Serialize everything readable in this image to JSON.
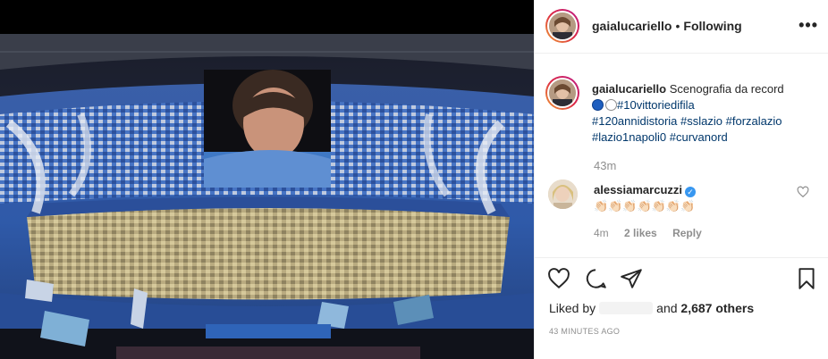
{
  "post": {
    "username": "gaialucariello",
    "separator": "•",
    "follow_status": "Following",
    "more_label": "•••"
  },
  "caption": {
    "username": "gaialucariello",
    "text": "Scenografia da record",
    "hashtags": [
      "#10vittoriedifila",
      "#120annidistoria",
      "#sslazio",
      "#forzalazio",
      "#lazio1napoli0",
      "#curvanord"
    ],
    "time": "43m"
  },
  "reply": {
    "username": "alessiamarcuzzi",
    "verified_icon": "verified-badge-icon",
    "emoji": "👏🏻👏🏻👏🏻👏🏻👏🏻👏🏻👏🏻",
    "time": "4m",
    "likes": "2 likes",
    "reply_label": "Reply"
  },
  "actions": {
    "icons": [
      "heart-icon",
      "comment-icon",
      "share-icon",
      "bookmark-icon"
    ]
  },
  "likes": {
    "prefix": "Liked by",
    "conjunction": "and",
    "count": "2,687 others"
  },
  "posted_time": "43 MINUTES AGO",
  "colors": {
    "link": "#00376b",
    "muted": "#8e8e8e",
    "verified": "#3897f0",
    "story_ring": "#dc2743"
  }
}
